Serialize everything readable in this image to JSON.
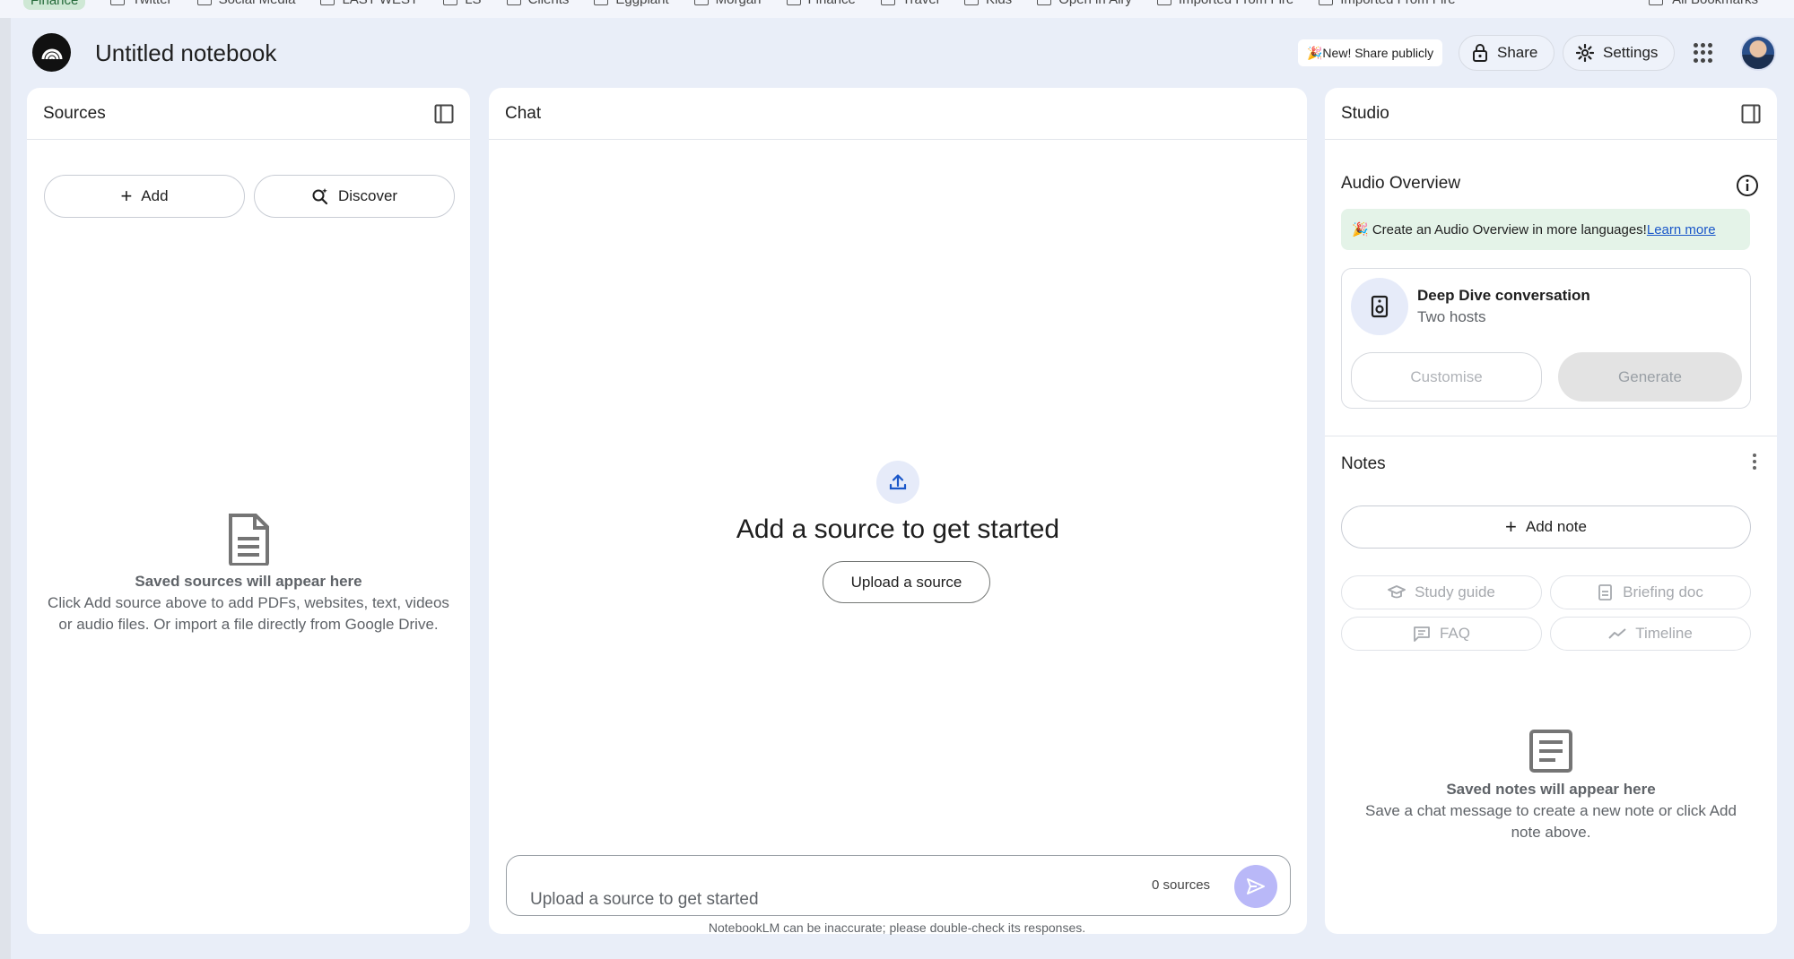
{
  "bookmarks": {
    "items": [
      "Finance",
      "Twitter",
      "Social Media",
      "LAST WEST",
      "LS",
      "Clients",
      "Eggplant",
      "Morgan",
      "Finance",
      "Travel",
      "Kids",
      "Open in Airy",
      "Imported From Fire",
      "Imported From Fire"
    ],
    "right_label": "All Bookmarks"
  },
  "header": {
    "notebook_title": "Untitled notebook",
    "new_share_label": "🎉New! Share publicly",
    "share_label": "Share",
    "settings_label": "Settings"
  },
  "sources": {
    "title": "Sources",
    "add_label": "Add",
    "discover_label": "Discover",
    "empty_title": "Saved sources will appear here",
    "empty_body": "Click Add source above to add PDFs, websites, text, videos or audio files. Or import a file directly from Google Drive."
  },
  "chat": {
    "title": "Chat",
    "headline": "Add a source to get started",
    "upload_label": "Upload a source",
    "input_placeholder": "Upload a source to get started",
    "source_count": "0 sources",
    "disclaimer": "NotebookLM can be inaccurate; please double-check its responses."
  },
  "studio": {
    "title": "Studio",
    "audio_overview_title": "Audio Overview",
    "banner_text": "🎉 Create an Audio Overview in more languages!",
    "banner_link": "Learn more",
    "deep_dive_title": "Deep Dive conversation",
    "deep_dive_sub": "Two hosts",
    "customise_label": "Customise",
    "generate_label": "Generate",
    "notes_title": "Notes",
    "add_note_label": "Add note",
    "study_guide_label": "Study guide",
    "briefing_doc_label": "Briefing doc",
    "faq_label": "FAQ",
    "timeline_label": "Timeline",
    "notes_empty_title": "Saved notes will appear here",
    "notes_empty_body": "Save a chat message to create a new note or click Add note above."
  },
  "colors": {
    "app_bg": "#e9eef8",
    "panel_bg": "#ffffff",
    "send_button": "#b9b8f8",
    "banner_bg": "#e4f3e8",
    "link": "#1a57c9"
  }
}
